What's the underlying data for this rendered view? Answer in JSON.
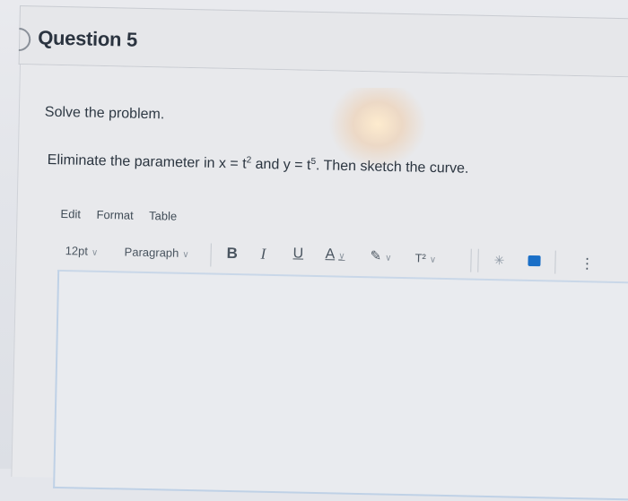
{
  "question": {
    "title": "Question 5"
  },
  "content": {
    "instruction": "Solve the problem.",
    "problem": {
      "prefix": "Eliminate the parameter in x = t",
      "exp1": "2",
      "middle": " and y = t",
      "exp2": "5",
      "suffix": ". Then sketch the curve."
    }
  },
  "editor": {
    "menu": [
      "Edit",
      "Format",
      "Table"
    ],
    "toolbar": {
      "font_size": "12pt",
      "block_format": "Paragraph",
      "bold": "B",
      "italic": "I",
      "underline": "U",
      "text_color": "A",
      "superscript": "T²",
      "more": "⋮"
    },
    "icons": [
      "chevron-down-icon",
      "highlight-pen-icon",
      "sparkle-icon",
      "embed-icon",
      "more-icon"
    ],
    "colors": {
      "accent": "#1a6fc7",
      "editor_border": "#bfd1e6"
    }
  }
}
